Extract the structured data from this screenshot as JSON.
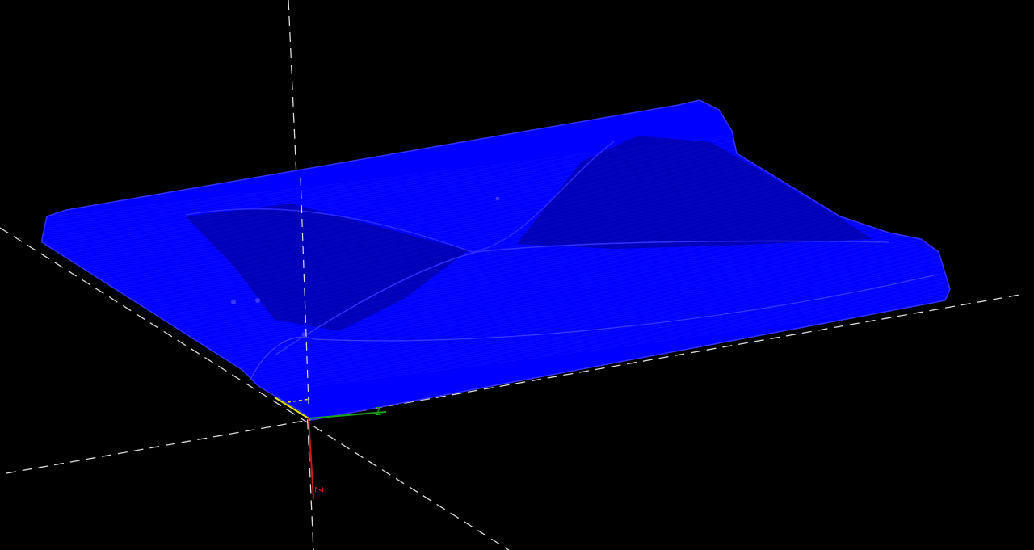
{
  "scene": {
    "background": "#000000",
    "mesh_color": "#0000ff",
    "mesh_edge_color": "#1a1aff",
    "dashed_axis_color": "#dcdcdc"
  },
  "axis_triad": {
    "x_axis": {
      "color": "#e6e600"
    },
    "y_axis": {
      "color": "#1aa31a",
      "label": "Z"
    },
    "z_axis": {
      "color": "#cc1a1a",
      "label": "Z"
    }
  }
}
